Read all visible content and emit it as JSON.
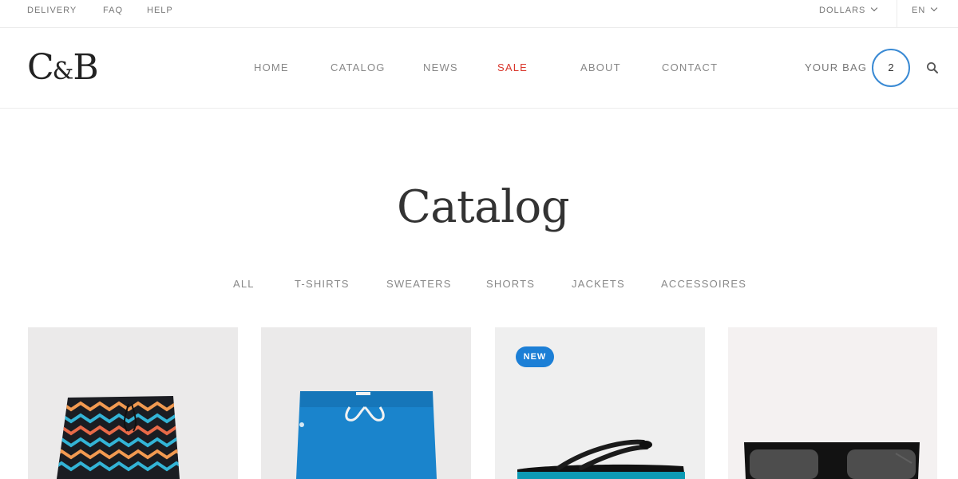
{
  "topbar": {
    "links": [
      "DELIVERY",
      "FAQ",
      "HELP"
    ],
    "currency": "DOLLARS",
    "language": "EN"
  },
  "header": {
    "logo": {
      "left": "C",
      "amp": "&",
      "right": "B"
    },
    "nav": [
      "HOME",
      "CATALOG",
      "NEWS",
      "SALE",
      "ABOUT",
      "CONTACT"
    ],
    "bag_label": "YOUR BAG",
    "bag_count": "2"
  },
  "main": {
    "title": "Catalog",
    "filters": [
      "ALL",
      "T-SHIRTS",
      "SWEATERS",
      "SHORTS",
      "JACKETS",
      "ACCESSOIRES"
    ],
    "products": [
      {
        "icon": "patterned-swim-shorts-image"
      },
      {
        "icon": "blue-sweat-shorts-image"
      },
      {
        "icon": "flip-flop-image",
        "badge": "NEW"
      },
      {
        "icon": "sunglasses-image"
      }
    ]
  },
  "colors": {
    "accent": "#1c7fd6",
    "sale": "#d9362b",
    "bag_ring": "#3a8ad4"
  }
}
